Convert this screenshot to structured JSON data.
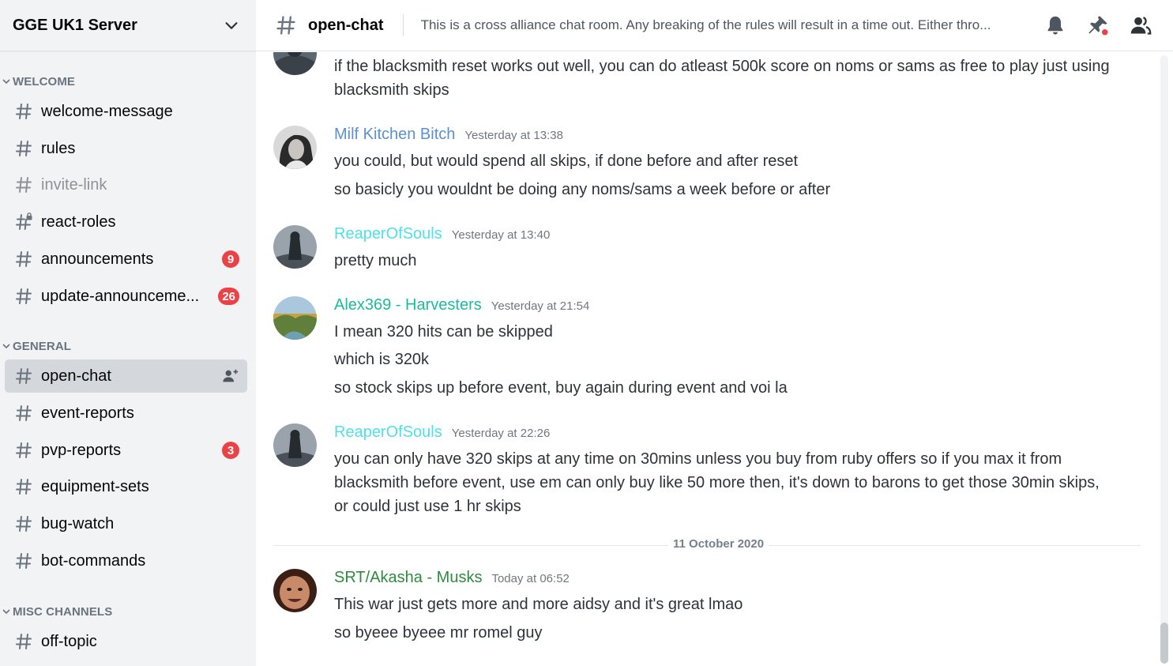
{
  "server": {
    "name": "GGE UK1 Server"
  },
  "sidebar": {
    "categories": [
      {
        "label": "WELCOME"
      },
      {
        "label": "GENERAL"
      },
      {
        "label": "MISC CHANNELS"
      }
    ],
    "channels": [
      {
        "label": "welcome-message"
      },
      {
        "label": "rules"
      },
      {
        "label": "invite-link"
      },
      {
        "label": "react-roles"
      },
      {
        "label": "announcements",
        "badge": "9"
      },
      {
        "label": "update-announceme...",
        "badge": "26"
      },
      {
        "label": "open-chat"
      },
      {
        "label": "event-reports"
      },
      {
        "label": "pvp-reports",
        "badge": "3"
      },
      {
        "label": "equipment-sets"
      },
      {
        "label": "bug-watch"
      },
      {
        "label": "bot-commands"
      },
      {
        "label": "off-topic"
      }
    ]
  },
  "header": {
    "channel": "open-chat",
    "topic": "This is a cross alliance chat room. Any breaking of the rules will result in a time out. Either thro..."
  },
  "messages": [
    {
      "author": "",
      "time": "",
      "lines": [
        "if the blacksmith reset works out well, you can do atleast 500k score on noms or sams as free to play just using blacksmith skips"
      ]
    },
    {
      "author": "Milf Kitchen Bitch",
      "author_color": "#5b8fd6",
      "time": "Yesterday at 13:38",
      "lines": [
        "you could, but would spend all skips, if done before and after reset",
        "so basicly you wouldnt be doing any noms/sams a week before or after"
      ]
    },
    {
      "author": "ReaperOfSouls",
      "author_color": "#4fe0e8",
      "time": "Yesterday at 13:40",
      "lines": [
        "pretty much"
      ]
    },
    {
      "author": "Alex369 - Harvesters",
      "author_color": "#1abc9c",
      "time": "Yesterday at 21:54",
      "lines": [
        "I mean 320 hits can be skipped",
        "which is 320k",
        "so stock skips up before event, buy again during event and voi la"
      ]
    },
    {
      "author": "ReaperOfSouls",
      "author_color": "#4fe0e8",
      "time": "Yesterday at 22:26",
      "lines": [
        "you can only have 320 skips at any time on 30mins unless you buy from ruby offers so if you max it from blacksmith before event, use em can only buy like 50 more then, it's down to barons to get those 30min skips, or could just use 1 hr skips"
      ]
    },
    {
      "author": "SRT/Akasha - Musks",
      "author_color": "#2e8b3e",
      "time": "Today at 06:52",
      "lines": [
        "This war just gets more and more aidsy and it's great lmao",
        "so byeee byeee mr romel guy"
      ]
    }
  ],
  "date_divider": "11 October 2020",
  "icons": {
    "server_menu": "chevron-down-icon",
    "channel": "hash-icon",
    "locked_channel": "hash-lock-icon",
    "invite": "add-member-icon",
    "notifications": "bell-icon",
    "pins": "pin-icon",
    "members": "members-icon"
  },
  "colors": {
    "sidebar_bg": "#f2f3f5",
    "selected_channel": "#d4d7dc",
    "badge": "#ed4245",
    "pin_alert_dot": "#ed4245"
  }
}
